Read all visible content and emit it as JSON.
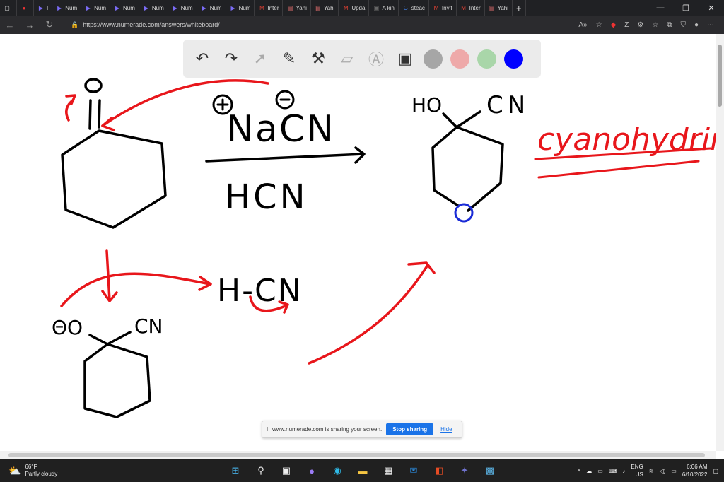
{
  "browser": {
    "tabs": [
      {
        "label": "",
        "icon": "window-icon"
      },
      {
        "label": "",
        "icon": "record-icon"
      },
      {
        "label": "I",
        "icon": "numerade-icon"
      },
      {
        "label": "Num",
        "icon": "numerade-icon"
      },
      {
        "label": "Num",
        "icon": "numerade-icon"
      },
      {
        "label": "Num",
        "icon": "numerade-icon"
      },
      {
        "label": "Num",
        "icon": "numerade-icon"
      },
      {
        "label": "Num",
        "icon": "numerade-icon"
      },
      {
        "label": "Num",
        "icon": "numerade-icon"
      },
      {
        "label": "Num",
        "icon": "numerade-icon"
      },
      {
        "label": "Inter",
        "icon": "gmail-icon"
      },
      {
        "label": "Yahi",
        "icon": "doc-icon"
      },
      {
        "label": "Yahi",
        "icon": "doc-icon"
      },
      {
        "label": "Upda",
        "icon": "gmail-icon"
      },
      {
        "label": "A kin",
        "icon": "page-icon"
      },
      {
        "label": "steac",
        "icon": "google-icon"
      },
      {
        "label": "Invit",
        "icon": "gmail-icon"
      },
      {
        "label": "Inter",
        "icon": "gmail-icon"
      },
      {
        "label": "Yahi",
        "icon": "doc-icon"
      }
    ],
    "new_tab": "+",
    "window_controls": [
      "—",
      "❐",
      "✕"
    ],
    "url": "https://www.numerade.com/answers/whiteboard/"
  },
  "whiteboard": {
    "tools": [
      "undo-icon",
      "redo-icon",
      "pointer-icon",
      "pen-icon",
      "tools-icon",
      "eraser-icon",
      "text-icon",
      "image-icon"
    ],
    "colors": [
      "#a6a6a6",
      "#eea9a9",
      "#a9d6a9",
      "#0000ff"
    ],
    "ink": {
      "red": "#e8161b",
      "black": "#000000",
      "blue": "#1a2bd6"
    },
    "labels": {
      "reagent_top": "NaCN",
      "reagent_bottom": "HCN",
      "product_left": "HO",
      "product_right": "CN",
      "cyanohydrin": "cyanohydrin",
      "hcn": "H-CN",
      "intermediate_left": "ΘO",
      "intermediate_right": "CN",
      "plus": "+",
      "minus": "−"
    }
  },
  "share_banner": {
    "text": "www.numerade.com is sharing your screen.",
    "stop": "Stop sharing",
    "hide": "Hide"
  },
  "taskbar": {
    "temp": "66°F",
    "weather": "Partly cloudy",
    "lang1": "ENG",
    "lang2": "US",
    "time": "6:06 AM",
    "date": "6/10/2022"
  }
}
